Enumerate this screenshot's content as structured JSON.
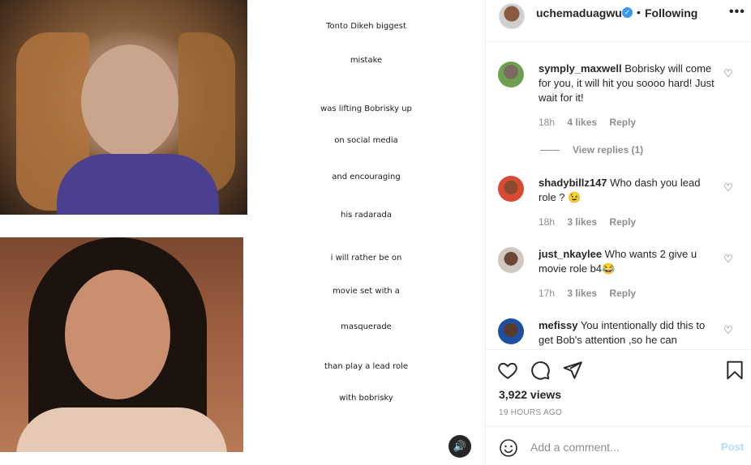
{
  "post": {
    "caption_lines": [
      "Tonto Dikeh biggest",
      "mistake",
      "was lifting Bobrisky up",
      "on social media",
      "and encouraging",
      "his radarada",
      "i will rather be on",
      "movie set with a",
      "masquerade",
      "than play a lead role",
      "with bobrisky"
    ],
    "sound_icon": "speaker-icon"
  },
  "header": {
    "username": "uchemaduagwu",
    "verified_icon": "verified-badge-icon",
    "separator": "•",
    "follow_label": "Following",
    "more_icon": "more-dots-icon",
    "more_label": "•••"
  },
  "comments": [
    {
      "username": "symply_maxwell",
      "text": "Bobrisky will come for you, it will hit you soooo hard! Just wait for it!",
      "time": "18h",
      "likes": "4 likes",
      "reply_label": "Reply",
      "view_replies": "View replies (1)"
    },
    {
      "username": "shadybillz147",
      "text": "Who dash you lead role ? 😉",
      "time": "18h",
      "likes": "3 likes",
      "reply_label": "Reply"
    },
    {
      "username": "just_nkaylee",
      "text": "Who wants 2 give u movie role b4😂",
      "time": "17h",
      "likes": "3 likes",
      "reply_label": "Reply"
    },
    {
      "username": "mefissy",
      "text": "You intentionally did this to get Bob's attention ,so he can"
    }
  ],
  "actions": {
    "like_icon": "heart-icon",
    "comment_icon": "comment-bubble-icon",
    "share_icon": "paper-plane-icon",
    "save_icon": "bookmark-icon",
    "views": "3,922 views",
    "time_ago": "19 HOURS AGO"
  },
  "add_comment": {
    "emoji_icon": "emoji-smile-icon",
    "placeholder": "Add a comment...",
    "post_label": "Post"
  },
  "colors": {
    "accent_disabled": "#b3dbff",
    "verified": "#3897f0",
    "muted": "#8e8e8e",
    "text": "#262626"
  }
}
